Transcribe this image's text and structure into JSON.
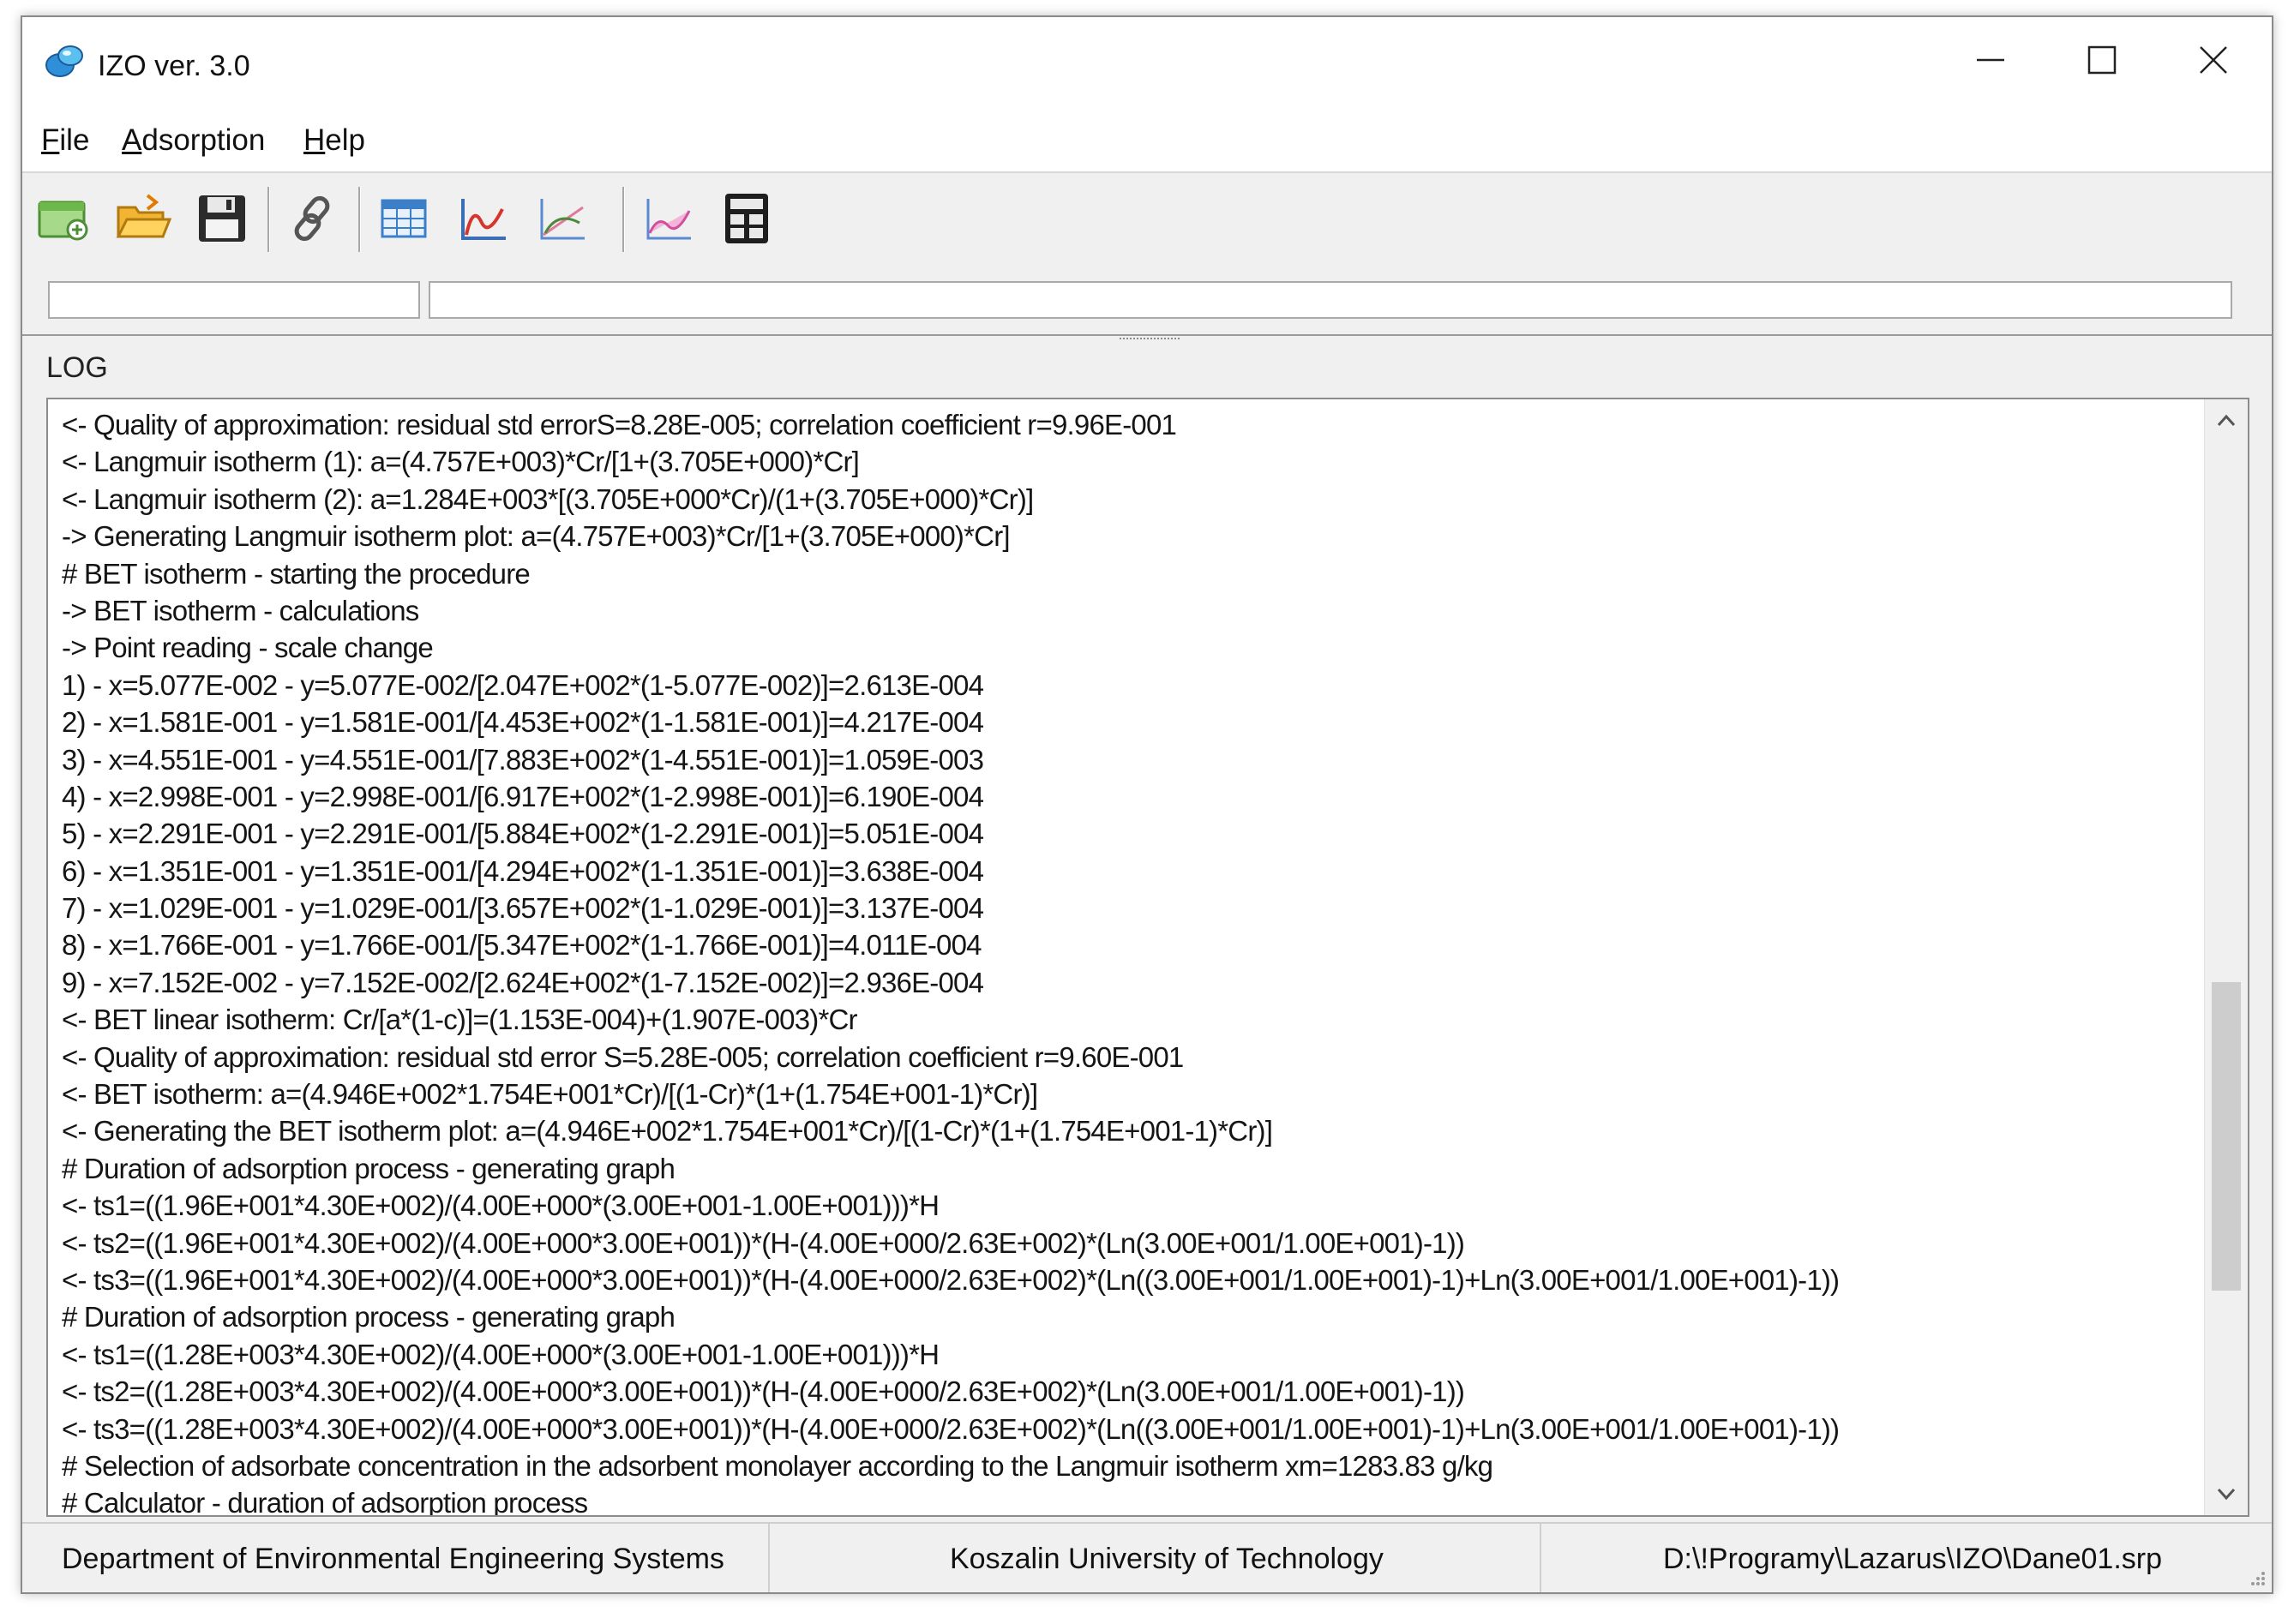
{
  "window": {
    "title": "IZO ver. 3.0"
  },
  "menu": {
    "items": [
      {
        "accel": "F",
        "rest": "ile"
      },
      {
        "accel": "A",
        "rest": "dsorption"
      },
      {
        "accel": "H",
        "rest": "elp"
      }
    ]
  },
  "toolbar": {
    "icons": [
      "new-data-icon",
      "open-folder-icon",
      "save-disk-icon",
      "link-icon",
      "table-icon",
      "isotherm-chart-icon",
      "linear-chart-icon",
      "plot-icon",
      "calculator-icon"
    ]
  },
  "log": {
    "label": "LOG",
    "scroll_position_fraction": 0.75,
    "lines": [
      "<- Quality of approximation: residual std errorS=8.28E-005; correlation coefficient r=9.96E-001",
      "<- Langmuir isotherm (1): a=(4.757E+003)*Cr/[1+(3.705E+000)*Cr]",
      "<- Langmuir isotherm (2): a=1.284E+003*[(3.705E+000*Cr)/(1+(3.705E+000)*Cr)]",
      "-> Generating Langmuir isotherm plot: a=(4.757E+003)*Cr/[1+(3.705E+000)*Cr]",
      "# BET isotherm - starting the procedure",
      "-> BET isotherm - calculations",
      "-> Point reading - scale change",
      "1) - x=5.077E-002 - y=5.077E-002/[2.047E+002*(1-5.077E-002)]=2.613E-004",
      "2) - x=1.581E-001 - y=1.581E-001/[4.453E+002*(1-1.581E-001)]=4.217E-004",
      "3) - x=4.551E-001 - y=4.551E-001/[7.883E+002*(1-4.551E-001)]=1.059E-003",
      "4) - x=2.998E-001 - y=2.998E-001/[6.917E+002*(1-2.998E-001)]=6.190E-004",
      "5) - x=2.291E-001 - y=2.291E-001/[5.884E+002*(1-2.291E-001)]=5.051E-004",
      "6) - x=1.351E-001 - y=1.351E-001/[4.294E+002*(1-1.351E-001)]=3.638E-004",
      "7) - x=1.029E-001 - y=1.029E-001/[3.657E+002*(1-1.029E-001)]=3.137E-004",
      "8) - x=1.766E-001 - y=1.766E-001/[5.347E+002*(1-1.766E-001)]=4.011E-004",
      "9) - x=7.152E-002 - y=7.152E-002/[2.624E+002*(1-7.152E-002)]=2.936E-004",
      "<- BET linear isotherm: Cr/[a*(1-c)]=(1.153E-004)+(1.907E-003)*Cr",
      "<- Quality of approximation: residual std error S=5.28E-005; correlation coefficient r=9.60E-001",
      "<- BET isotherm: a=(4.946E+002*1.754E+001*Cr)/[(1-Cr)*(1+(1.754E+001-1)*Cr)]",
      "<- Generating the BET isotherm plot: a=(4.946E+002*1.754E+001*Cr)/[(1-Cr)*(1+(1.754E+001-1)*Cr)]",
      "# Duration of adsorption process - generating graph",
      "<- ts1=((1.96E+001*4.30E+002)/(4.00E+000*(3.00E+001-1.00E+001)))*H",
      "<- ts2=((1.96E+001*4.30E+002)/(4.00E+000*3.00E+001))*(H-(4.00E+000/2.63E+002)*(Ln(3.00E+001/1.00E+001)-1))",
      "<- ts3=((1.96E+001*4.30E+002)/(4.00E+000*3.00E+001))*(H-(4.00E+000/2.63E+002)*(Ln((3.00E+001/1.00E+001)-1)+Ln(3.00E+001/1.00E+001)-1))",
      "# Duration of adsorption process - generating graph",
      "<- ts1=((1.28E+003*4.30E+002)/(4.00E+000*(3.00E+001-1.00E+001)))*H",
      "<- ts2=((1.28E+003*4.30E+002)/(4.00E+000*3.00E+001))*(H-(4.00E+000/2.63E+002)*(Ln(3.00E+001/1.00E+001)-1))",
      "<- ts3=((1.28E+003*4.30E+002)/(4.00E+000*3.00E+001))*(H-(4.00E+000/2.63E+002)*(Ln((3.00E+001/1.00E+001)-1)+Ln(3.00E+001/1.00E+001)-1))",
      "# Selection of adsorbate concentration in the adsorbent monolayer according to the Langmuir isotherm xm=1283.83 g/kg",
      "# Calculator - duration of adsorption process"
    ]
  },
  "status": {
    "department": "Department of Environmental Engineering Systems",
    "university": "Koszalin University of Technology",
    "file_path": "D:\\!Programy\\Lazarus\\IZO\\Dane01.srp"
  }
}
